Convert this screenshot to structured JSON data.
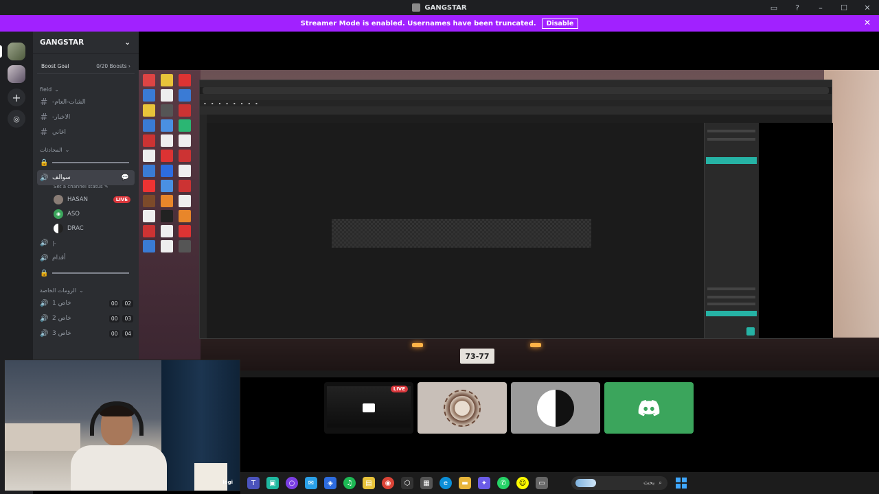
{
  "window": {
    "title": "GANGSTAR"
  },
  "banner": {
    "text": "Streamer Mode is enabled. Usernames have been truncated.",
    "button": "Disable"
  },
  "server": {
    "name": "GANGSTAR",
    "boost_label": "Boost Goal",
    "boost_count": "0/20 Boosts"
  },
  "categories": {
    "field": "field",
    "conversations": "المحادثات",
    "private_rooms": "الرومات الخاصة"
  },
  "text_channels": [
    {
      "name": "-الشات-العام"
    },
    {
      "name": "-الاخبار"
    },
    {
      "name": "اغاني"
    }
  ],
  "voice_channels": {
    "active": {
      "name": "سوالف",
      "status": "Set a channel status"
    },
    "members": [
      {
        "name": "HASAN",
        "live": "LIVE"
      },
      {
        "name": "ASO"
      },
      {
        "name": "DRAC"
      }
    ],
    "games": "أقدام",
    "private": [
      {
        "name": "خاص 1",
        "count_a": "00",
        "count_b": "02"
      },
      {
        "name": "خاص 2",
        "count_a": "00",
        "count_b": "03"
      },
      {
        "name": "خاص 3",
        "count_a": "00",
        "count_b": "04"
      }
    ]
  },
  "stream": {
    "plate": "73-77"
  },
  "tiles": {
    "live_label": "LIVE"
  },
  "webcam": {
    "brand": "logi"
  },
  "taskbar": {
    "search_text": "بحث"
  },
  "colors": {
    "accent": "#a121ff",
    "live": "#da373c",
    "discord_green": "#3ba55c",
    "teal": "#26b3a5"
  }
}
